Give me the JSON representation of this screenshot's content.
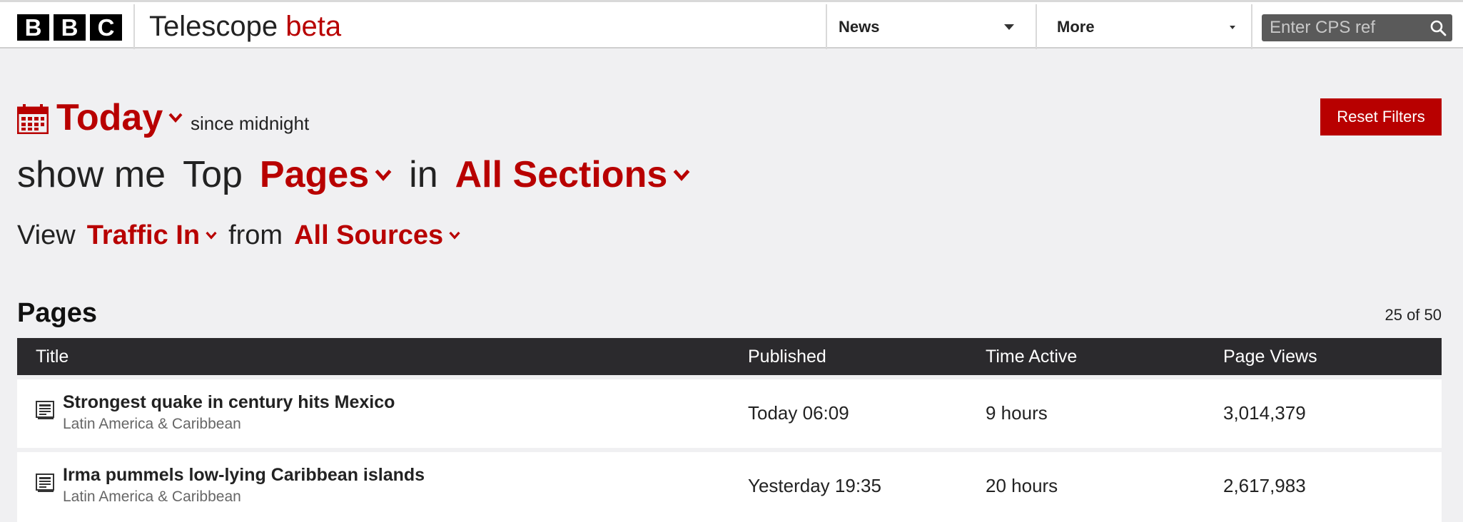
{
  "header": {
    "logo_letters": [
      "B",
      "B",
      "C"
    ],
    "app_name": "Telescope",
    "app_badge": "beta",
    "nav_news": "News",
    "nav_more": "More",
    "search_placeholder": "Enter CPS ref",
    "search_icon": "search-icon"
  },
  "filters": {
    "date_label": "Today",
    "date_note": "since midnight",
    "calendar_icon": "calendar-icon",
    "show_me": "show me",
    "top": "Top",
    "content_type": "Pages",
    "in": "in",
    "section": "All Sections",
    "view": "View",
    "traffic": "Traffic In",
    "from": "from",
    "sources": "All Sources",
    "reset_label": "Reset Filters"
  },
  "pages": {
    "heading": "Pages",
    "count": "25 of 50",
    "columns": {
      "title": "Title",
      "published": "Published",
      "time_active": "Time Active",
      "page_views": "Page Views"
    },
    "rows": [
      {
        "title": "Strongest quake in century hits Mexico",
        "section": "Latin America & Caribbean",
        "published": "Today 06:09",
        "time_active": "9 hours",
        "page_views": "3,014,379"
      },
      {
        "title": "Irma pummels low-lying Caribbean islands",
        "section": "Latin America & Caribbean",
        "published": "Yesterday 19:35",
        "time_active": "20 hours",
        "page_views": "2,617,983"
      }
    ]
  },
  "colors": {
    "brand_red": "#b80000",
    "table_header": "#2b2a2d",
    "page_bg": "#f0f0f2"
  }
}
